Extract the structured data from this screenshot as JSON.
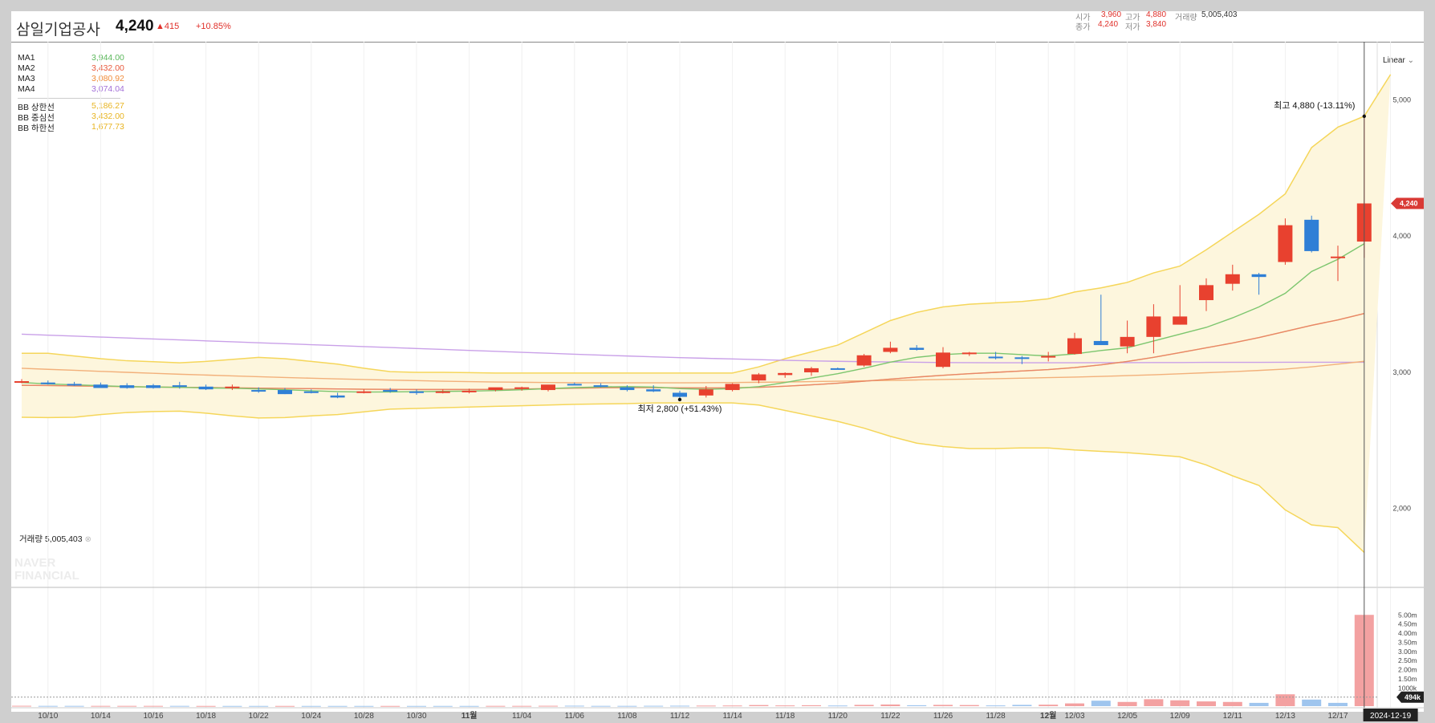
{
  "header": {
    "name": "삼일기업공사",
    "price": "4,240",
    "change": "▲415",
    "change_pct": "+10.85%",
    "open_label": "시가",
    "open": "3,960",
    "high_label": "고가",
    "high": "4,880",
    "volume_label": "거래량",
    "volume": "5,005,403",
    "close_label": "종가",
    "close": "4,240",
    "low_label": "저가",
    "low": "3,840"
  },
  "legend": [
    {
      "label": "MA1",
      "value": "3,944.00",
      "color": "#5cb85c"
    },
    {
      "label": "MA2",
      "value": "3,432.00",
      "color": "#e8593c"
    },
    {
      "label": "MA3",
      "value": "3,080.92",
      "color": "#f08c3a"
    },
    {
      "label": "MA4",
      "value": "3,074.04",
      "color": "#a370d8"
    },
    {
      "label": "BB 상한선",
      "value": "5,186.27",
      "color": "#f0c030"
    },
    {
      "label": "BB 중심선",
      "value": "3,432.00",
      "color": "#f0c030"
    },
    {
      "label": "BB 하한선",
      "value": "1,677.73",
      "color": "#f0c030"
    }
  ],
  "scale_mode": "Linear",
  "volume_panel_label": "거래량 5,005,403",
  "watermark": "NAVER FINANCIAL",
  "colors": {
    "up": "#e8412f",
    "down": "#2f7fd6",
    "band_fill": "#fdf6dd",
    "band_line": "#f5d65a",
    "price_tag": "#d93a35"
  },
  "chart_data": {
    "type": "candlestick",
    "title": "삼일기업공사",
    "y_price_ticks": [
      2000,
      3000,
      4000,
      5000
    ],
    "y_price_tick_labels": [
      "2,000",
      "3,000",
      "4,000",
      "5,000"
    ],
    "price_range": [
      1480,
      5380
    ],
    "volume_ticks": [
      500000,
      1000000,
      1500000,
      2000000,
      2500000,
      3000000,
      3500000,
      4000000,
      4500000,
      5000000
    ],
    "volume_tick_labels": [
      "",
      "1000k",
      "1.50m",
      "2.00m",
      "2.50m",
      "3.00m",
      "3.50m",
      "4.00m",
      "4.50m",
      "5.00m"
    ],
    "volume_range": [
      0,
      5500000
    ],
    "x_tick_labels": [
      "10/10",
      "10/14",
      "10/16",
      "10/18",
      "10/22",
      "10/24",
      "10/28",
      "10/30",
      "11월",
      "11/04",
      "11/06",
      "11/08",
      "11/12",
      "11/14",
      "11/18",
      "11/20",
      "11/22",
      "11/26",
      "11/28",
      "12월",
      "12/03",
      "12/05",
      "12/09",
      "12/11",
      "12/13",
      "12/17",
      "2024-12-19"
    ],
    "x_tick_index": [
      1,
      3,
      5,
      7,
      9,
      11,
      13,
      15,
      17,
      19,
      21,
      23,
      25,
      27,
      29,
      31,
      33,
      35,
      37,
      39,
      40,
      42,
      44,
      46,
      48,
      50,
      52
    ],
    "candles": [
      {
        "o": 2935,
        "h": 2950,
        "l": 2920,
        "c": 2935
      },
      {
        "o": 2925,
        "h": 2940,
        "l": 2910,
        "c": 2920
      },
      {
        "o": 2915,
        "h": 2930,
        "l": 2900,
        "c": 2910
      },
      {
        "o": 2910,
        "h": 2925,
        "l": 2885,
        "c": 2885
      },
      {
        "o": 2905,
        "h": 2920,
        "l": 2880,
        "c": 2885
      },
      {
        "o": 2905,
        "h": 2915,
        "l": 2880,
        "c": 2885
      },
      {
        "o": 2905,
        "h": 2930,
        "l": 2880,
        "c": 2900
      },
      {
        "o": 2895,
        "h": 2910,
        "l": 2870,
        "c": 2875
      },
      {
        "o": 2895,
        "h": 2910,
        "l": 2870,
        "c": 2895
      },
      {
        "o": 2870,
        "h": 2890,
        "l": 2850,
        "c": 2860
      },
      {
        "o": 2870,
        "h": 2885,
        "l": 2840,
        "c": 2840
      },
      {
        "o": 2860,
        "h": 2875,
        "l": 2845,
        "c": 2850
      },
      {
        "o": 2830,
        "h": 2850,
        "l": 2810,
        "c": 2815
      },
      {
        "o": 2860,
        "h": 2875,
        "l": 2845,
        "c": 2860
      },
      {
        "o": 2870,
        "h": 2885,
        "l": 2850,
        "c": 2860
      },
      {
        "o": 2860,
        "h": 2875,
        "l": 2835,
        "c": 2855
      },
      {
        "o": 2860,
        "h": 2875,
        "l": 2845,
        "c": 2860
      },
      {
        "o": 2865,
        "h": 2880,
        "l": 2845,
        "c": 2865
      },
      {
        "o": 2870,
        "h": 2885,
        "l": 2860,
        "c": 2890
      },
      {
        "o": 2880,
        "h": 2895,
        "l": 2865,
        "c": 2890
      },
      {
        "o": 2870,
        "h": 2905,
        "l": 2860,
        "c": 2910
      },
      {
        "o": 2915,
        "h": 2925,
        "l": 2905,
        "c": 2905
      },
      {
        "o": 2905,
        "h": 2920,
        "l": 2890,
        "c": 2900
      },
      {
        "o": 2890,
        "h": 2905,
        "l": 2860,
        "c": 2870
      },
      {
        "o": 2875,
        "h": 2905,
        "l": 2855,
        "c": 2860
      },
      {
        "o": 2850,
        "h": 2865,
        "l": 2800,
        "c": 2820
      },
      {
        "o": 2830,
        "h": 2900,
        "l": 2815,
        "c": 2875
      },
      {
        "o": 2870,
        "h": 2920,
        "l": 2860,
        "c": 2915
      },
      {
        "o": 2940,
        "h": 2995,
        "l": 2920,
        "c": 2985
      },
      {
        "o": 2980,
        "h": 3000,
        "l": 2960,
        "c": 2995
      },
      {
        "o": 3000,
        "h": 3040,
        "l": 2975,
        "c": 3030
      },
      {
        "o": 3030,
        "h": 3035,
        "l": 3020,
        "c": 3025
      },
      {
        "o": 3050,
        "h": 3135,
        "l": 3040,
        "c": 3125
      },
      {
        "o": 3150,
        "h": 3225,
        "l": 3140,
        "c": 3180
      },
      {
        "o": 3180,
        "h": 3200,
        "l": 3160,
        "c": 3165
      },
      {
        "o": 3040,
        "h": 3185,
        "l": 3030,
        "c": 3145
      },
      {
        "o": 3140,
        "h": 3150,
        "l": 3120,
        "c": 3145
      },
      {
        "o": 3115,
        "h": 3150,
        "l": 3095,
        "c": 3105
      },
      {
        "o": 3110,
        "h": 3120,
        "l": 3060,
        "c": 3100
      },
      {
        "o": 3110,
        "h": 3150,
        "l": 3080,
        "c": 3120
      },
      {
        "o": 3135,
        "h": 3290,
        "l": 3130,
        "c": 3250
      },
      {
        "o": 3230,
        "h": 3570,
        "l": 3220,
        "c": 3200
      },
      {
        "o": 3190,
        "h": 3380,
        "l": 3140,
        "c": 3260
      },
      {
        "o": 3260,
        "h": 3500,
        "l": 3140,
        "c": 3410
      },
      {
        "o": 3350,
        "h": 3640,
        "l": 3350,
        "c": 3410
      },
      {
        "o": 3530,
        "h": 3690,
        "l": 3450,
        "c": 3640
      },
      {
        "o": 3650,
        "h": 3790,
        "l": 3600,
        "c": 3720
      },
      {
        "o": 3720,
        "h": 3730,
        "l": 3570,
        "c": 3700
      },
      {
        "o": 3810,
        "h": 4130,
        "l": 3790,
        "c": 4080
      },
      {
        "o": 4120,
        "h": 4150,
        "l": 3880,
        "c": 3890
      },
      {
        "o": 3840,
        "h": 3930,
        "l": 3670,
        "c": 3850
      },
      {
        "o": 3960,
        "h": 4880,
        "l": 3840,
        "c": 4240
      }
    ],
    "volumes": [
      20000,
      15000,
      15000,
      15000,
      15000,
      15000,
      15000,
      12000,
      12000,
      12000,
      12000,
      12000,
      12000,
      12000,
      12000,
      12000,
      12000,
      12000,
      15000,
      15000,
      20000,
      25000,
      15000,
      15000,
      20000,
      25000,
      30000,
      35000,
      60000,
      40000,
      50000,
      35000,
      70000,
      90000,
      50000,
      70000,
      60000,
      40000,
      70000,
      80000,
      150000,
      300000,
      230000,
      380000,
      320000,
      260000,
      230000,
      180000,
      650000,
      360000,
      180000,
      5005403
    ],
    "volume_up": [
      true,
      false,
      false,
      true,
      true,
      true,
      false,
      true,
      false,
      false,
      true,
      false,
      false,
      false,
      true,
      false,
      false,
      false,
      true,
      true,
      true,
      false,
      false,
      false,
      false,
      false,
      true,
      true,
      true,
      true,
      true,
      false,
      true,
      true,
      false,
      true,
      true,
      false,
      false,
      true,
      true,
      false,
      true,
      true,
      true,
      true,
      true,
      false,
      true,
      false,
      false,
      true
    ],
    "ma1": [
      2925,
      2915,
      2908,
      2902,
      2895,
      2892,
      2890,
      2885,
      2883,
      2878,
      2872,
      2865,
      2858,
      2855,
      2856,
      2858,
      2860,
      2862,
      2866,
      2872,
      2880,
      2888,
      2893,
      2895,
      2892,
      2880,
      2875,
      2880,
      2895,
      2925,
      2958,
      2990,
      3030,
      3075,
      3110,
      3130,
      3140,
      3140,
      3130,
      3120,
      3135,
      3160,
      3180,
      3230,
      3280,
      3330,
      3400,
      3480,
      3580,
      3740,
      3830,
      3944
    ],
    "ma2": [
      2905,
      2903,
      2900,
      2898,
      2895,
      2892,
      2890,
      2888,
      2886,
      2884,
      2882,
      2880,
      2878,
      2876,
      2875,
      2874,
      2874,
      2874,
      2875,
      2877,
      2880,
      2883,
      2886,
      2888,
      2888,
      2886,
      2885,
      2886,
      2890,
      2898,
      2908,
      2920,
      2935,
      2950,
      2965,
      2978,
      2990,
      3000,
      3010,
      3020,
      3035,
      3055,
      3080,
      3110,
      3145,
      3180,
      3215,
      3255,
      3300,
      3345,
      3385,
      3432
    ],
    "ma3": [
      3030,
      3022,
      3015,
      3007,
      3000,
      2993,
      2986,
      2980,
      2974,
      2968,
      2962,
      2957,
      2952,
      2947,
      2943,
      2939,
      2935,
      2932,
      2929,
      2927,
      2925,
      2924,
      2923,
      2923,
      2923,
      2923,
      2924,
      2925,
      2927,
      2929,
      2932,
      2935,
      2938,
      2941,
      2944,
      2947,
      2950,
      2953,
      2957,
      2961,
      2965,
      2970,
      2976,
      2982,
      2989,
      2997,
      3005,
      3014,
      3024,
      3040,
      3060,
      3080.92
    ],
    "ma4": [
      3280,
      3273,
      3266,
      3259,
      3252,
      3245,
      3238,
      3231,
      3224,
      3217,
      3210,
      3203,
      3196,
      3189,
      3182,
      3175,
      3168,
      3161,
      3154,
      3147,
      3140,
      3133,
      3126,
      3120,
      3114,
      3108,
      3103,
      3098,
      3093,
      3088,
      3084,
      3081,
      3078,
      3076,
      3074,
      3072,
      3071,
      3070,
      3070,
      3070,
      3070,
      3071,
      3071,
      3072,
      3072,
      3073,
      3073,
      3073,
      3074,
      3074,
      3074,
      3074.04
    ],
    "bb_upper": [
      3140,
      3140,
      3120,
      3100,
      3085,
      3078,
      3070,
      3080,
      3095,
      3110,
      3100,
      3080,
      3060,
      3030,
      3005,
      3000,
      3000,
      2998,
      2995,
      2995,
      2995,
      2995,
      2995,
      2995,
      2995,
      2995,
      2995,
      2995,
      3040,
      3100,
      3150,
      3200,
      3290,
      3380,
      3440,
      3480,
      3500,
      3510,
      3520,
      3540,
      3590,
      3620,
      3660,
      3730,
      3780,
      3900,
      4030,
      4160,
      4310,
      4650,
      4800,
      4880,
      5186.27
    ],
    "bb_mid": [
      2905,
      2903,
      2900,
      2898,
      2895,
      2892,
      2890,
      2888,
      2886,
      2884,
      2882,
      2880,
      2878,
      2876,
      2875,
      2874,
      2874,
      2874,
      2875,
      2877,
      2880,
      2883,
      2886,
      2888,
      2888,
      2886,
      2885,
      2886,
      2890,
      2898,
      2908,
      2920,
      2935,
      2950,
      2965,
      2978,
      2990,
      3000,
      3010,
      3020,
      3035,
      3055,
      3080,
      3110,
      3145,
      3180,
      3215,
      3255,
      3300,
      3345,
      3385,
      3432
    ],
    "bb_lower": [
      2670,
      2668,
      2670,
      2690,
      2705,
      2712,
      2715,
      2700,
      2680,
      2665,
      2668,
      2680,
      2690,
      2710,
      2730,
      2735,
      2740,
      2745,
      2750,
      2755,
      2760,
      2765,
      2768,
      2770,
      2775,
      2775,
      2775,
      2775,
      2760,
      2720,
      2680,
      2640,
      2590,
      2530,
      2480,
      2455,
      2440,
      2440,
      2445,
      2445,
      2430,
      2420,
      2410,
      2395,
      2380,
      2320,
      2240,
      2170,
      1990,
      1880,
      1860,
      1677.73
    ],
    "annotations": [
      {
        "text": "최고 4,880 (-13.11%)",
        "index": 51,
        "value": 4880
      },
      {
        "text": "최저 2,800 (+51.43%)",
        "index": 25,
        "value": 2800
      }
    ],
    "last_price_label": "4,240",
    "last_volume_label": "494k",
    "last_volume_value": 494000
  }
}
